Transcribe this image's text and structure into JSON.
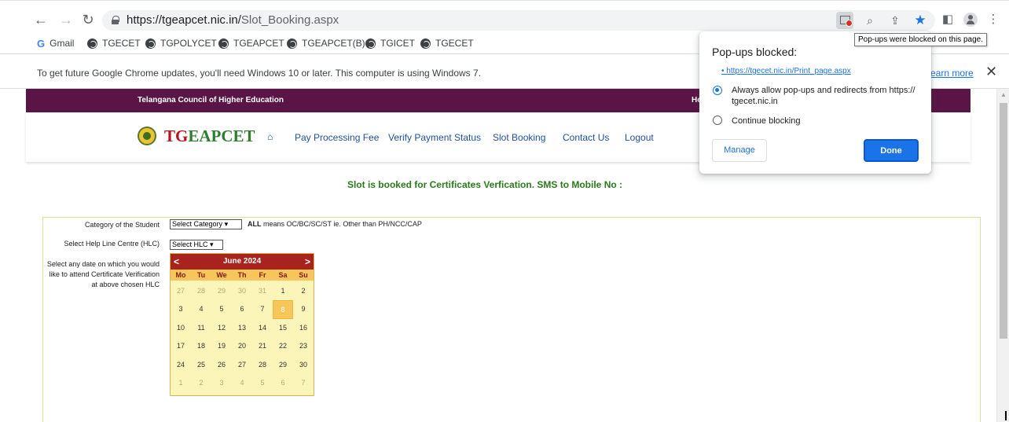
{
  "browser": {
    "url_host": "https://tgeapcet.nic.in/",
    "url_path": "Slot_Booking.aspx",
    "bookmarks": [
      {
        "label": "Gmail",
        "icon": "gmail-icon"
      },
      {
        "label": "TGECET",
        "icon": "globe-icon"
      },
      {
        "label": "TGPOLYCET",
        "icon": "globe-icon"
      },
      {
        "label": "TGEAPCET",
        "icon": "globe-icon"
      },
      {
        "label": "TGEAPCET(B)",
        "icon": "globe-icon"
      },
      {
        "label": "TGICET",
        "icon": "globe-icon"
      },
      {
        "label": "TGECET",
        "icon": "globe-icon"
      }
    ],
    "infobar_message": "To get future Google Chrome updates, you'll need Windows 10 or later. This computer is using Windows 7.",
    "infobar_link": "earn more",
    "tooltip": "Pop-ups were blocked on this page."
  },
  "popup": {
    "title": "Pop-ups blocked:",
    "blocked_link": "https://tgecet.nic.in/Print_page.aspx",
    "option_allow": "Always allow pop-ups and redirects from https:// tgecet.nic.in",
    "option_block": "Continue blocking",
    "manage_label": "Manage",
    "done_label": "Done"
  },
  "site": {
    "council": "Telangana Council of Higher Education",
    "help_partial": "He",
    "logo_tg": "TG",
    "logo_rest": "EAPCET",
    "nav": [
      "Pay Processing Fee",
      "Verify Payment Status",
      "Slot Booking",
      "Contact Us",
      "Logout"
    ],
    "booked_message": "Slot is booked for Certificates Verfication. SMS to Mobile No :"
  },
  "form": {
    "category_label": "Category of the Student",
    "category_value": "Select Category",
    "category_note_bold": "ALL",
    "category_note": " means OC/BC/SC/ST ie. Other than PH/NCC/CAP",
    "hlc_label": "Select Help Line Centre (HLC)",
    "hlc_value": "Select HLC",
    "date_label": "Select any date on which you would like to attend Certificate Verification at above chosen HLC"
  },
  "calendar": {
    "prev": "<",
    "next": ">",
    "title": "June 2024",
    "weekdays": [
      "Mo",
      "Tu",
      "We",
      "Th",
      "Fr",
      "Sa",
      "Su"
    ],
    "selected_day": "8",
    "weeks": [
      [
        {
          "d": "27",
          "o": true
        },
        {
          "d": "28",
          "o": true
        },
        {
          "d": "29",
          "o": true
        },
        {
          "d": "30",
          "o": true
        },
        {
          "d": "31",
          "o": true
        },
        {
          "d": "1"
        },
        {
          "d": "2"
        }
      ],
      [
        {
          "d": "3"
        },
        {
          "d": "4"
        },
        {
          "d": "5"
        },
        {
          "d": "6"
        },
        {
          "d": "7"
        },
        {
          "d": "8"
        },
        {
          "d": "9"
        }
      ],
      [
        {
          "d": "10"
        },
        {
          "d": "11"
        },
        {
          "d": "12"
        },
        {
          "d": "13"
        },
        {
          "d": "14"
        },
        {
          "d": "15"
        },
        {
          "d": "16"
        }
      ],
      [
        {
          "d": "17"
        },
        {
          "d": "18"
        },
        {
          "d": "19"
        },
        {
          "d": "20"
        },
        {
          "d": "21"
        },
        {
          "d": "22"
        },
        {
          "d": "23"
        }
      ],
      [
        {
          "d": "24"
        },
        {
          "d": "25"
        },
        {
          "d": "26"
        },
        {
          "d": "27"
        },
        {
          "d": "28"
        },
        {
          "d": "29"
        },
        {
          "d": "30"
        }
      ],
      [
        {
          "d": "1",
          "o": true
        },
        {
          "d": "2",
          "o": true
        },
        {
          "d": "3",
          "o": true
        },
        {
          "d": "4",
          "o": true
        },
        {
          "d": "5",
          "o": true
        },
        {
          "d": "6",
          "o": true
        },
        {
          "d": "7",
          "o": true
        }
      ]
    ]
  }
}
